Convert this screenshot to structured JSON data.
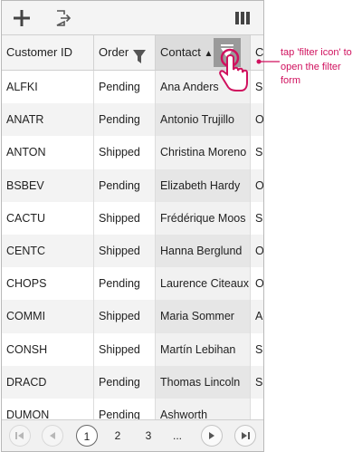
{
  "toolbar": {
    "add_icon": "plus-icon",
    "export_icon": "export-icon",
    "columns_icon": "column-chooser-icon"
  },
  "columns": {
    "customer_id": "Customer ID",
    "order": "Order",
    "contact": "Contact",
    "contact_sort": "▲",
    "partial": "C"
  },
  "rows": [
    {
      "id": "ALFKI",
      "order": "Pending",
      "contact": "Ana Anders",
      "extra": "Sa"
    },
    {
      "id": "ANATR",
      "order": "Pending",
      "contact": "Antonio Trujillo",
      "extra": "Ov"
    },
    {
      "id": "ANTON",
      "order": "Shipped",
      "contact": "Christina Moreno",
      "extra": "Sa"
    },
    {
      "id": "BSBEV",
      "order": "Pending",
      "contact": "Elizabeth Hardy",
      "extra": "Ov"
    },
    {
      "id": "CACTU",
      "order": "Shipped",
      "contact": "Frédérique Moos",
      "extra": "Sa"
    },
    {
      "id": "CENTC",
      "order": "Shipped",
      "contact": "Hanna Berglund",
      "extra": "Ov"
    },
    {
      "id": "CHOPS",
      "order": "Pending",
      "contact": "Laurence Citeaux",
      "extra": "Ov"
    },
    {
      "id": "COMMI",
      "order": "Shipped",
      "contact": "Maria Sommer",
      "extra": "Ac"
    },
    {
      "id": "CONSH",
      "order": "Shipped",
      "contact": "Martín Lebihan",
      "extra": "Sa"
    },
    {
      "id": "DRACD",
      "order": "Pending",
      "contact": "Thomas Lincoln",
      "extra": "Sa"
    },
    {
      "id": "DUMON",
      "order": "Pending",
      "contact": "Ashworth",
      "extra": ""
    }
  ],
  "pager": {
    "pages": [
      "1",
      "2",
      "3"
    ],
    "ellipsis": "...",
    "current": "1"
  },
  "callout": {
    "text": "tap 'filter icon' to open the filter form",
    "color": "#d0115e"
  }
}
